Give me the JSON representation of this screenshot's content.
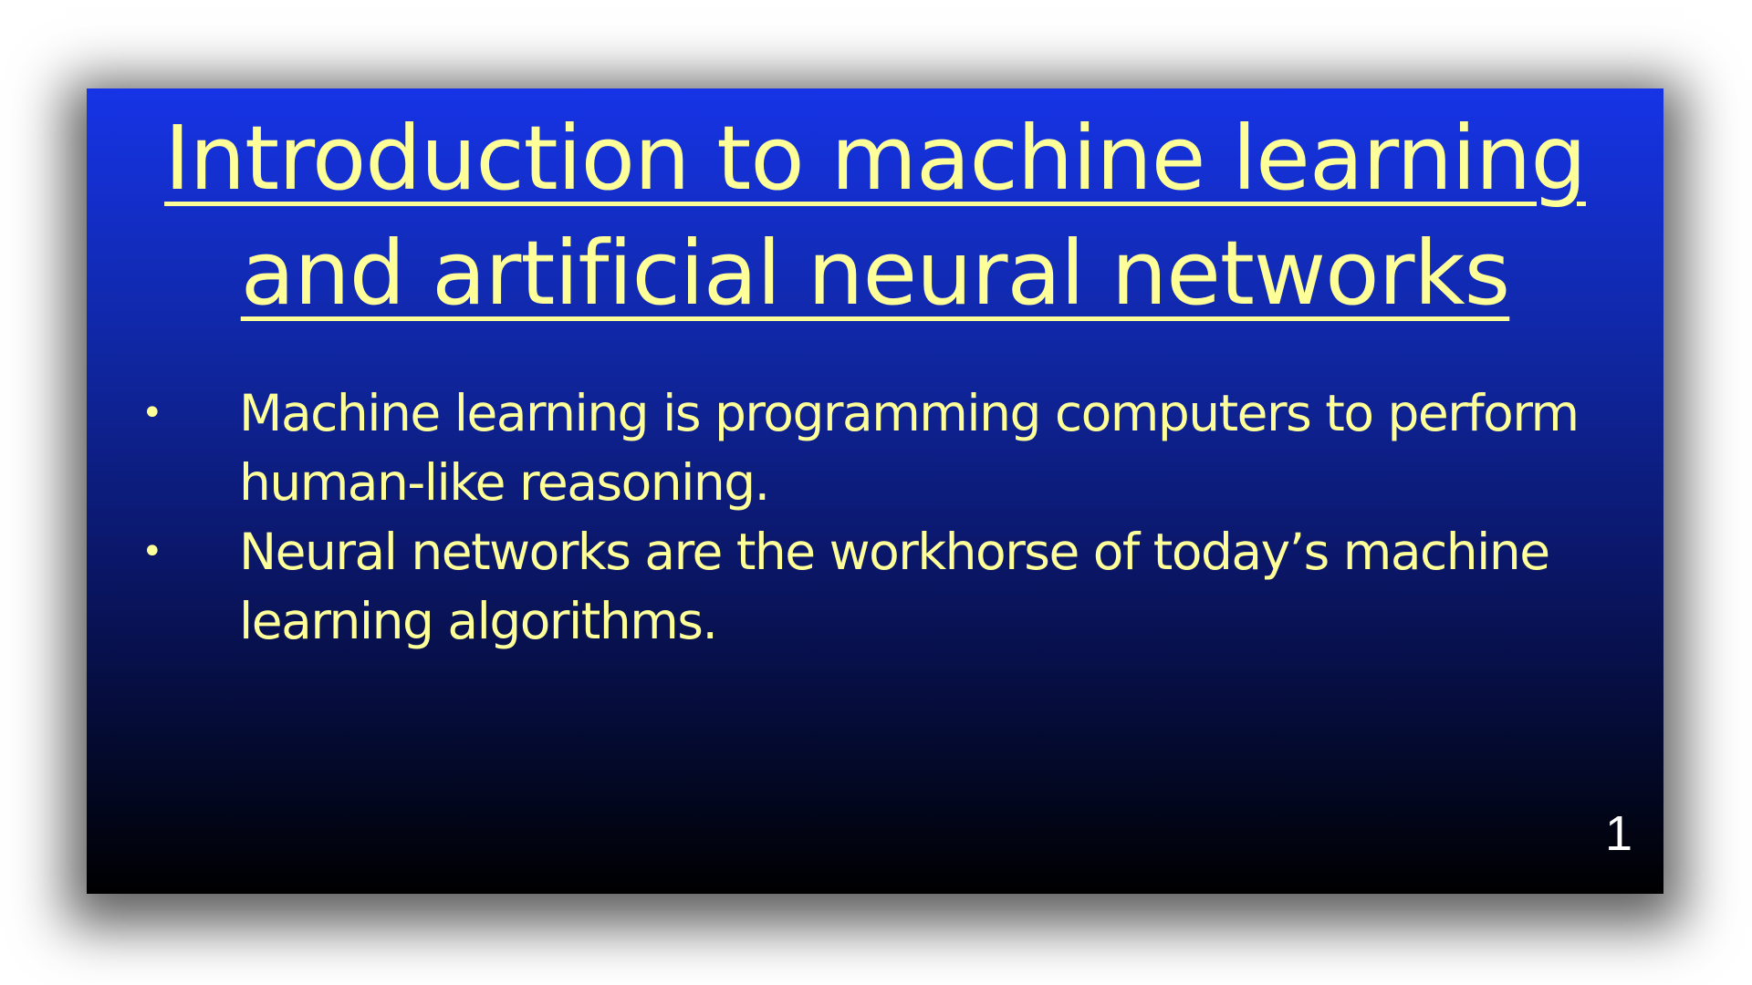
{
  "slide": {
    "title_lines": [
      "Introduction to machine learning",
      "and artificial neural networks"
    ],
    "bullets": [
      "Machine learning is programming computers to perform human-like reasoning.",
      "Neural networks are the workhorse of today’s machine learning algorithms."
    ],
    "bullet_symbol": "•",
    "page_number": "1",
    "colors": {
      "title_text": "#ffff99",
      "body_text": "#ffff99",
      "background_top": "#1634e6",
      "background_bottom": "#000000",
      "page_number": "#ffffff"
    }
  }
}
